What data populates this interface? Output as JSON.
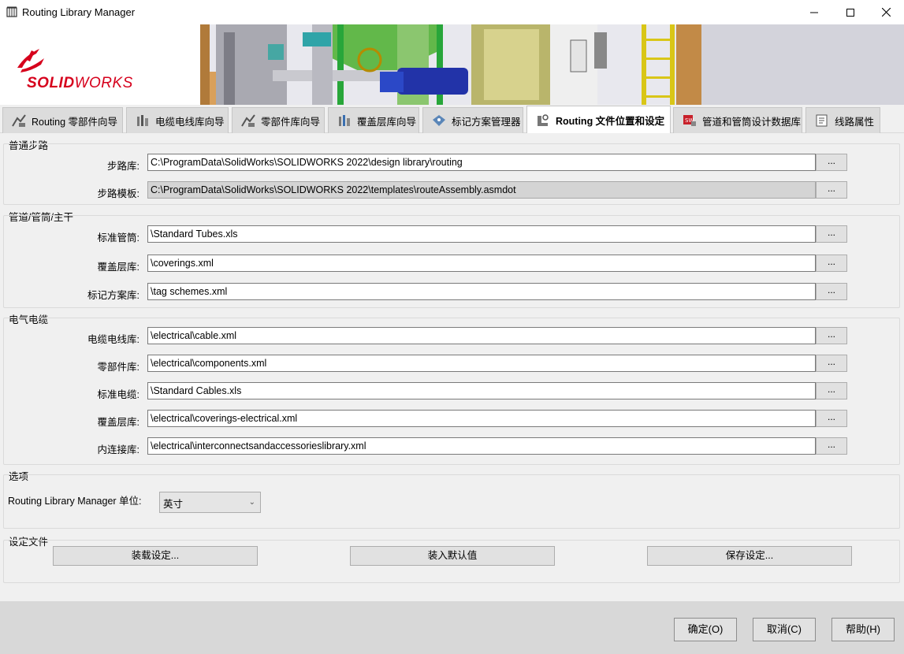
{
  "window": {
    "title": "Routing Library Manager",
    "minimize_icon": "minimize-icon",
    "maximize_icon": "maximize-icon",
    "close_icon": "close-icon"
  },
  "banner": {
    "logo_bold": "SOLID",
    "logo_thin": "WORKS",
    "brand_color": "#d6001c"
  },
  "tabs": [
    {
      "label": "Routing 零部件向导",
      "icon": "routing-component-icon",
      "active": false
    },
    {
      "label": "电缆电线库向导",
      "icon": "cable-library-icon",
      "active": false
    },
    {
      "label": "零部件库向导",
      "icon": "component-library-icon",
      "active": false
    },
    {
      "label": "覆盖层库向导",
      "icon": "covering-library-icon",
      "active": false
    },
    {
      "label": "标记方案管理器",
      "icon": "tag-scheme-icon",
      "active": false
    },
    {
      "label": "Routing 文件位置和设定",
      "icon": "file-locations-icon",
      "active": true
    },
    {
      "label": "管道和管筒设计数据库",
      "icon": "pipe-database-icon",
      "active": false
    },
    {
      "label": "线路属性",
      "icon": "route-properties-icon",
      "active": false
    }
  ],
  "sections": {
    "general": {
      "title": "普通步路",
      "fields": [
        {
          "label": "步路库:",
          "value": "C:\\ProgramData\\SolidWorks\\SOLIDWORKS 2022\\design library\\routing",
          "readonly": false
        },
        {
          "label": "步路模板:",
          "value": "C:\\ProgramData\\SolidWorks\\SOLIDWORKS 2022\\templates\\routeAssembly.asmdot",
          "readonly": true
        }
      ]
    },
    "pipe": {
      "title": "管道/管筒/主干",
      "fields": [
        {
          "label": "标准管筒:",
          "value": "\\Standard Tubes.xls"
        },
        {
          "label": "覆盖层库:",
          "value": "\\coverings.xml"
        },
        {
          "label": "标记方案库:",
          "value": "\\tag schemes.xml"
        }
      ]
    },
    "electrical": {
      "title": "电气电缆",
      "fields": [
        {
          "label": "电缆电线库:",
          "value": "\\electrical\\cable.xml"
        },
        {
          "label": "零部件库:",
          "value": "\\electrical\\components.xml"
        },
        {
          "label": "标准电缆:",
          "value": "\\Standard Cables.xls"
        },
        {
          "label": "覆盖层库:",
          "value": "\\electrical\\coverings-electrical.xml"
        },
        {
          "label": "内连接库:",
          "value": "\\electrical\\interconnectsandaccessorieslibrary.xml"
        }
      ]
    },
    "options": {
      "title": "选项",
      "units_label": "Routing Library Manager 单位:",
      "units_value": "英寸"
    },
    "settings_file": {
      "title": "设定文件",
      "load_label": "装载设定...",
      "defaults_label": "装入默认值",
      "save_label": "保存设定..."
    }
  },
  "browse_label": "...",
  "footer": {
    "ok_label": "确定(O)",
    "cancel_label": "取消(C)",
    "help_label": "帮助(H)"
  }
}
